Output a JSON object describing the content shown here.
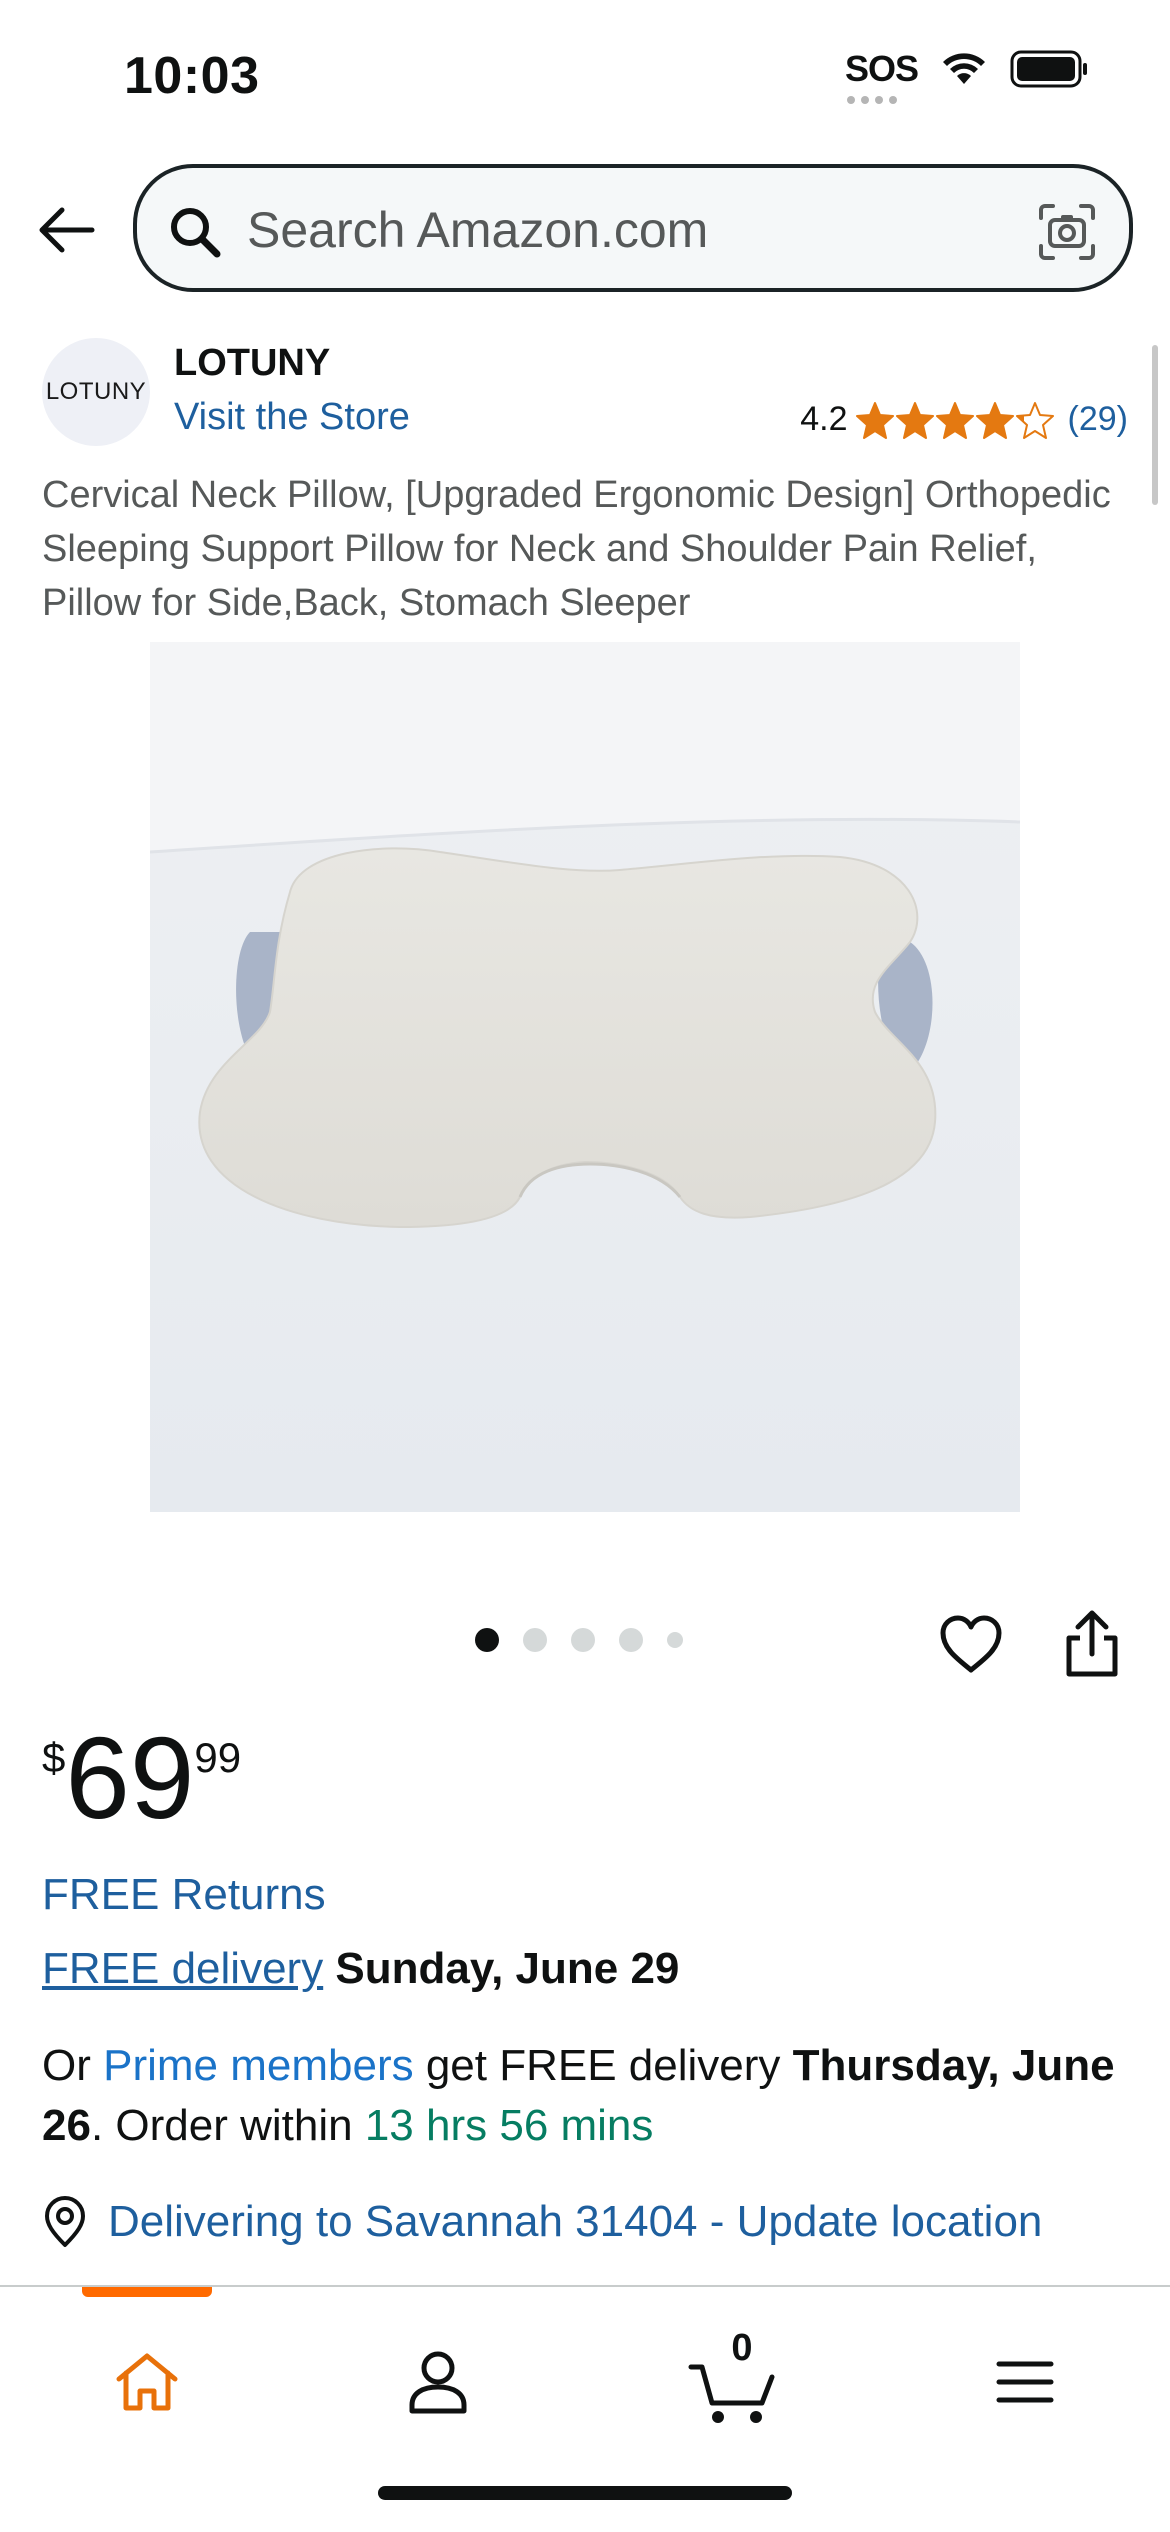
{
  "status_bar": {
    "time": "10:03",
    "sos": "SOS"
  },
  "search": {
    "placeholder": "Search Amazon.com"
  },
  "brand": {
    "logo_text": "LOTUNY",
    "name": "LOTUNY",
    "visit_store": "Visit the Store",
    "rating": "4.2",
    "rating_fraction": 0.84,
    "review_count": "(29)"
  },
  "product": {
    "title": "Cervical Neck Pillow, [Upgraded Ergonomic Design] Orthopedic Sleeping Support Pillow for Neck and Shoulder Pain Relief, Pillow for Side,Back, Stomach Sleeper",
    "carousel_total": 5,
    "carousel_active": 1
  },
  "price": {
    "symbol": "$",
    "whole": "69",
    "fraction": "99"
  },
  "delivery": {
    "free_returns": "FREE Returns",
    "free_delivery_link": "FREE delivery",
    "free_delivery_date": "Sunday, June 29",
    "prime_prefix": "Or ",
    "prime_link": "Prime members",
    "prime_middle": " get FREE delivery ",
    "prime_date": "Thursday, June 26",
    "order_within": ". Order within ",
    "countdown": "13 hrs 56 mins",
    "location": "Delivering to Savannah 31404 - Update location"
  },
  "nav": {
    "cart_count": "0",
    "active": "home"
  },
  "colors": {
    "link": "#1e5f9e",
    "prime_link": "#1a73c8",
    "countdown": "#067d62",
    "star": "#e47911",
    "nav_active": "#ff6a00"
  }
}
